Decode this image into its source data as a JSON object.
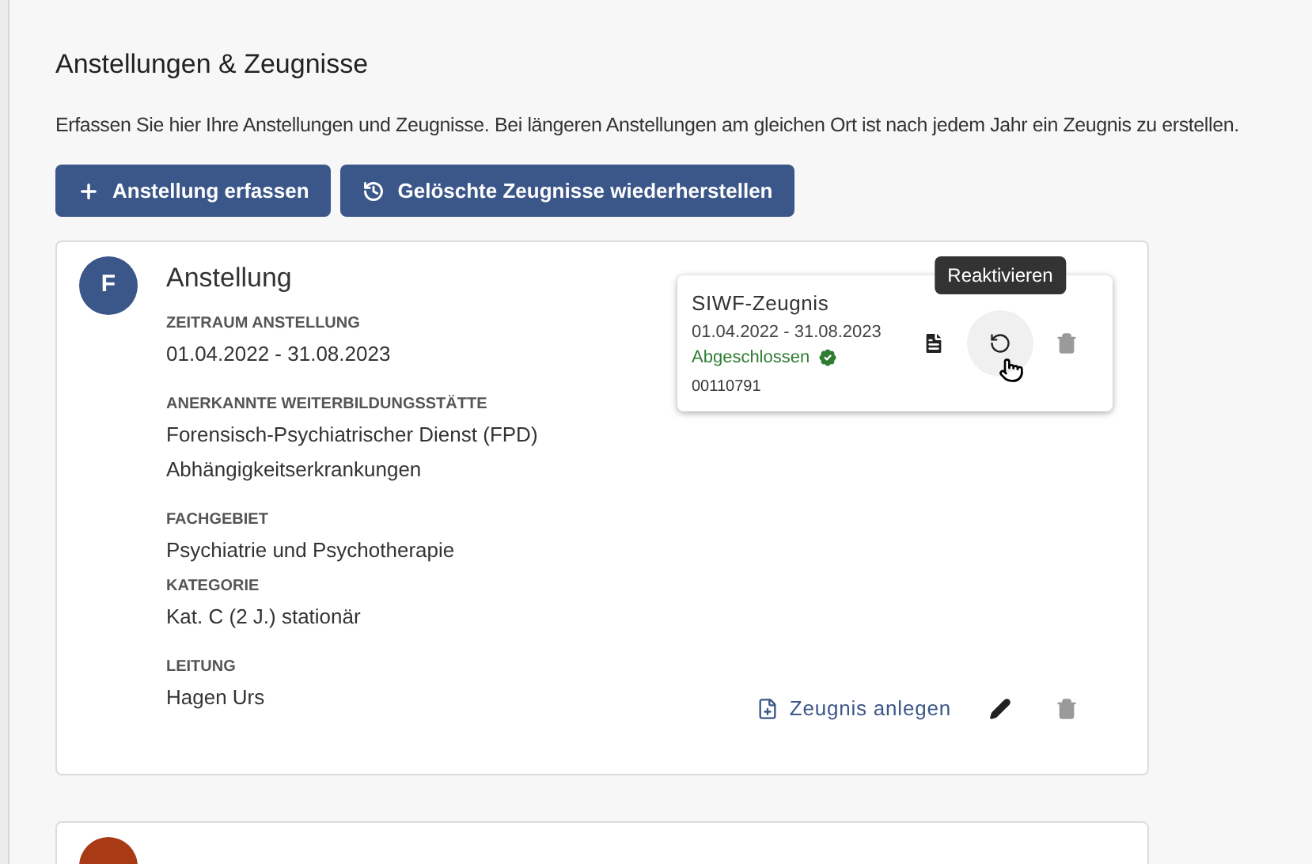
{
  "page": {
    "title": "Anstellungen & Zeugnisse",
    "description": "Erfassen Sie hier Ihre Anstellungen und Zeugnisse. Bei längeren Anstellungen am gleichen Ort ist nach jedem Jahr ein Zeugnis zu erstellen."
  },
  "buttons": [
    {
      "kind": "add",
      "label": "Anstellung erfassen"
    },
    {
      "kind": "restore",
      "label": "Gelöschte Zeugnisse wiederherstellen"
    }
  ],
  "cards": [
    {
      "avatar": "F",
      "color": "#3b5688",
      "title": "Anstellung",
      "fields": [
        {
          "label": "ZEITRAUM ANSTELLUNG",
          "lines": [
            "01.04.2022 - 31.08.2023"
          ]
        },
        {
          "label": "ANERKANNTE WEITERBILDUNGSSTÄTTE",
          "lines": [
            "Forensisch-Psychiatrischer Dienst (FPD)",
            "Abhängigkeitserkrankungen"
          ]
        },
        {
          "label": "FACHGEBIET",
          "lines": [
            "Psychiatrie und Psychotherapie"
          ]
        },
        {
          "label": "KATEGORIE",
          "lines": [
            "Kat. C (2 J.) stationär"
          ]
        },
        {
          "label": "LEITUNG",
          "lines": [
            "Hagen Urs"
          ]
        }
      ],
      "certificates": [
        {
          "title": "SIWF-Zeugnis",
          "dates": "01.04.2022 - 31.08.2023",
          "status": "Abgeschlossen",
          "number": "00110791",
          "actions": [
            {
              "kind": "document",
              "hovered": false,
              "disabled": false
            },
            {
              "kind": "reactivate",
              "hovered": true,
              "disabled": false,
              "tooltip": "Reaktivieren"
            },
            {
              "kind": "delete",
              "hovered": false,
              "disabled": true
            }
          ]
        }
      ],
      "footer": {
        "link": "Zeugnis anlegen",
        "actions": [
          {
            "kind": "edit",
            "disabled": false
          },
          {
            "kind": "delete",
            "disabled": true
          }
        ]
      }
    },
    {
      "color": "#a83a16"
    }
  ]
}
